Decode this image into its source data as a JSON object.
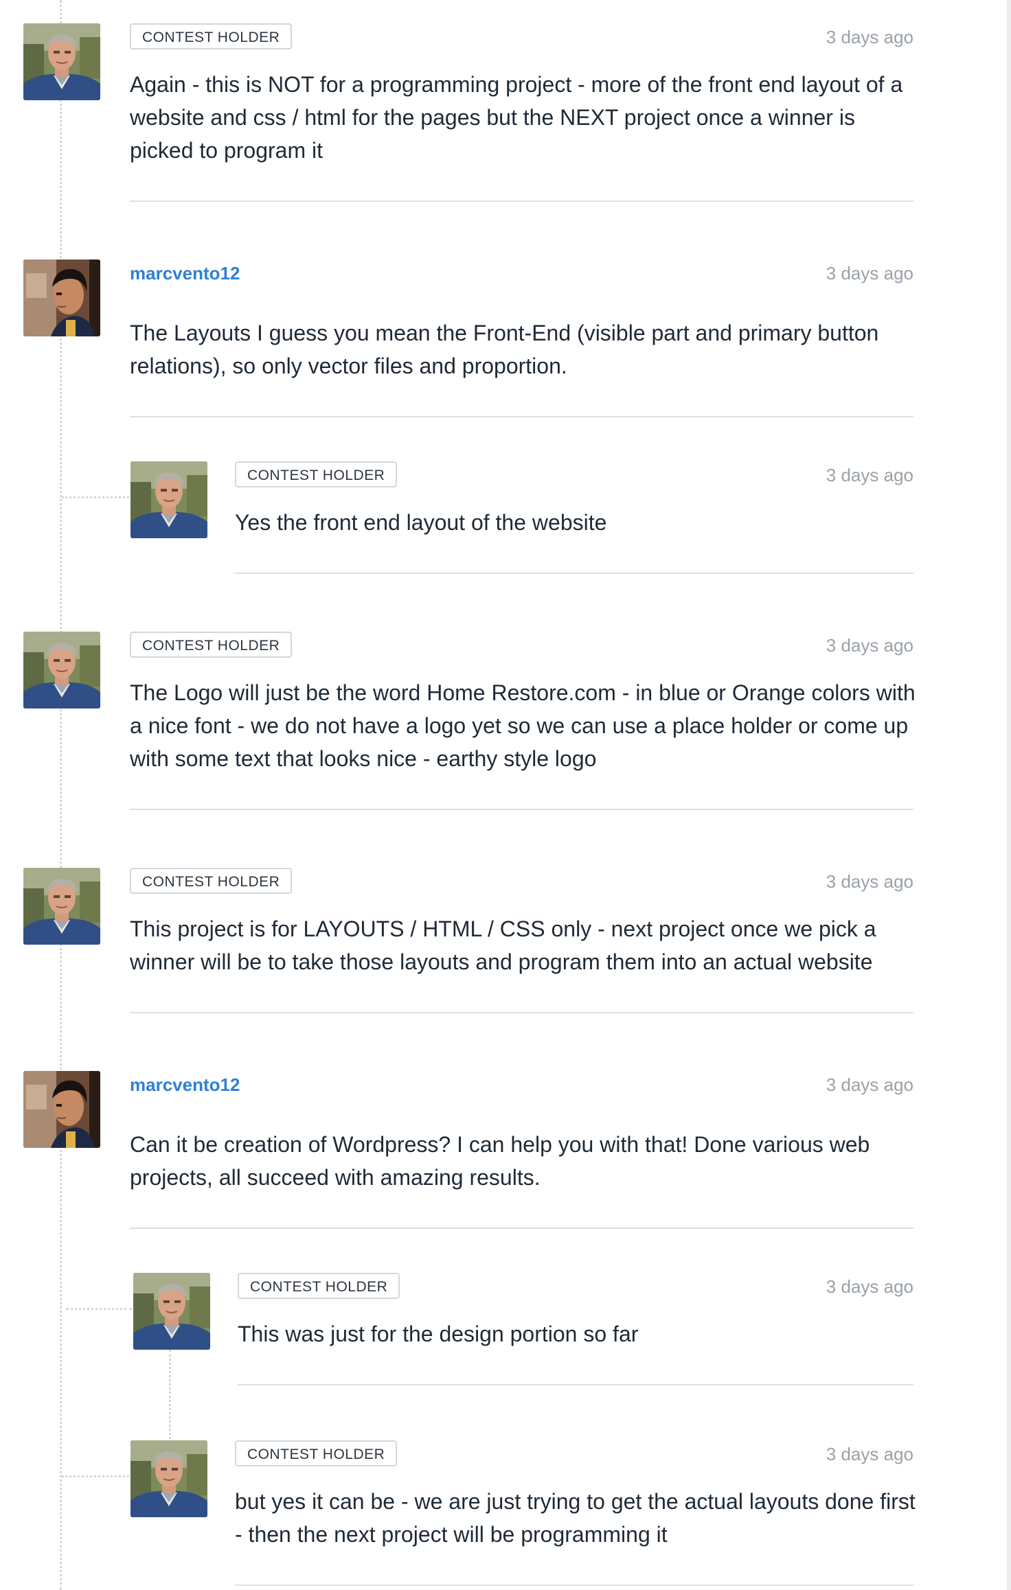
{
  "comments": [
    {
      "role_badge": "CONTEST HOLDER",
      "time": "3 days ago",
      "text": "Again - this is NOT for a programming project - more of the front end layout of a website and css / html for the pages but the NEXT project once a winner is picked to program it"
    },
    {
      "username": "marcvento12",
      "time": "3 days ago",
      "text": "The Layouts I guess you mean the Front-End (visible part and primary button relations), so only vector files and proportion."
    },
    {
      "role_badge": "CONTEST HOLDER",
      "time": "3 days ago",
      "text": "Yes the front end layout of the website"
    },
    {
      "role_badge": "CONTEST HOLDER",
      "time": "3 days ago",
      "text": "The Logo will just be the word Home Restore.com - in blue or Orange colors with a nice font - we do not have a logo yet so we can use a place holder or come up with some text that looks nice - earthy style logo"
    },
    {
      "role_badge": "CONTEST HOLDER",
      "time": "3 days ago",
      "text": "This project is for LAYOUTS / HTML / CSS only - next project once we pick a winner will be to take those layouts and program them into an actual website"
    },
    {
      "username": "marcvento12",
      "time": "3 days ago",
      "text": "Can it be creation of Wordpress? I can help you with that! Done various web projects, all succeed with amazing results."
    },
    {
      "role_badge": "CONTEST HOLDER",
      "time": "3 days ago",
      "text": "This was just for the design portion so far"
    },
    {
      "role_badge": "CONTEST HOLDER",
      "time": "3 days ago",
      "text": "but yes it can be - we are just trying to get the actual layouts done first - then the next project will be programming it"
    }
  ],
  "colors": {
    "username": "#2f7fd2",
    "timestamp": "#9aa1a8",
    "text": "#1f2a36",
    "badge_border": "#d3d7db"
  },
  "icons": {
    "holder_avatar": "contest-holder-avatar",
    "user_avatar": "marcvento12-avatar"
  }
}
